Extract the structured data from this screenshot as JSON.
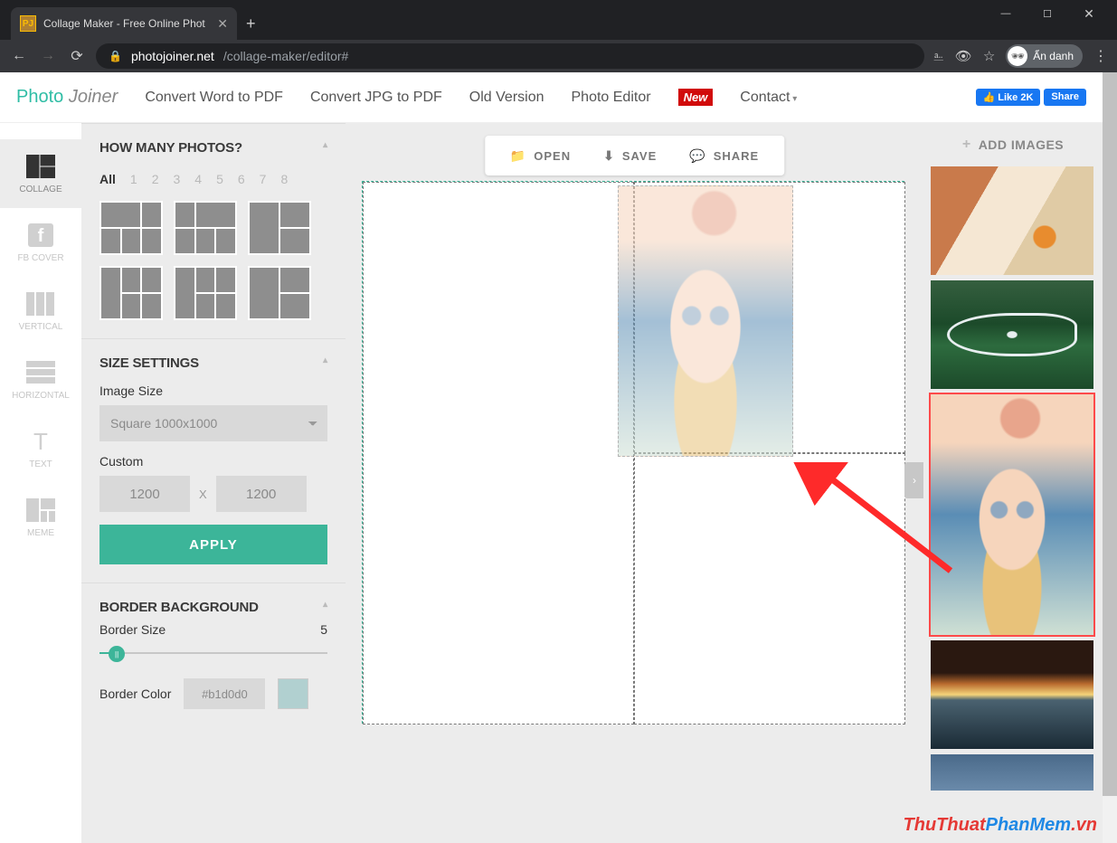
{
  "browser": {
    "tab_title": "Collage Maker - Free Online Phot",
    "url_domain": "photojoiner.net",
    "url_path": "/collage-maker/editor#",
    "profile_label": "Ẩn danh"
  },
  "topnav": {
    "brand_part1": "Photo",
    "brand_part2": "Joiner",
    "links": {
      "convert_word": "Convert Word to PDF",
      "convert_jpg": "Convert JPG to PDF",
      "old_version": "Old Version",
      "photo_editor": "Photo Editor",
      "new_badge": "New",
      "contact": "Contact"
    },
    "fb_like": "Like 2K",
    "fb_share": "Share"
  },
  "rail": {
    "collage": "COLLAGE",
    "fbcover": "FB COVER",
    "vertical": "VERTICAL",
    "horizontal": "HORIZONTAL",
    "text": "TEXT",
    "meme": "MEME"
  },
  "panel": {
    "photos_header": "HOW MANY PHOTOS?",
    "counts": [
      "All",
      "1",
      "2",
      "3",
      "4",
      "5",
      "6",
      "7",
      "8"
    ],
    "counts_active": "All",
    "size_header": "SIZE SETTINGS",
    "image_size_label": "Image Size",
    "image_size_value": "Square 1000x1000",
    "custom_label": "Custom",
    "custom_w": "1200",
    "custom_h": "1200",
    "x_sep": "X",
    "apply": "APPLY",
    "border_header": "BORDER BACKGROUND",
    "border_size_label": "Border Size",
    "border_size_value": "5",
    "border_color_label": "Border Color",
    "border_color_hex": "#b1d0d0"
  },
  "toolbar": {
    "open": "OPEN",
    "save": "SAVE",
    "share": "SHARE"
  },
  "images_col": {
    "add": "ADD IMAGES"
  },
  "watermark": {
    "t1": "ThuThuat",
    "t2": "PhanMem",
    "t3": ".vn"
  }
}
